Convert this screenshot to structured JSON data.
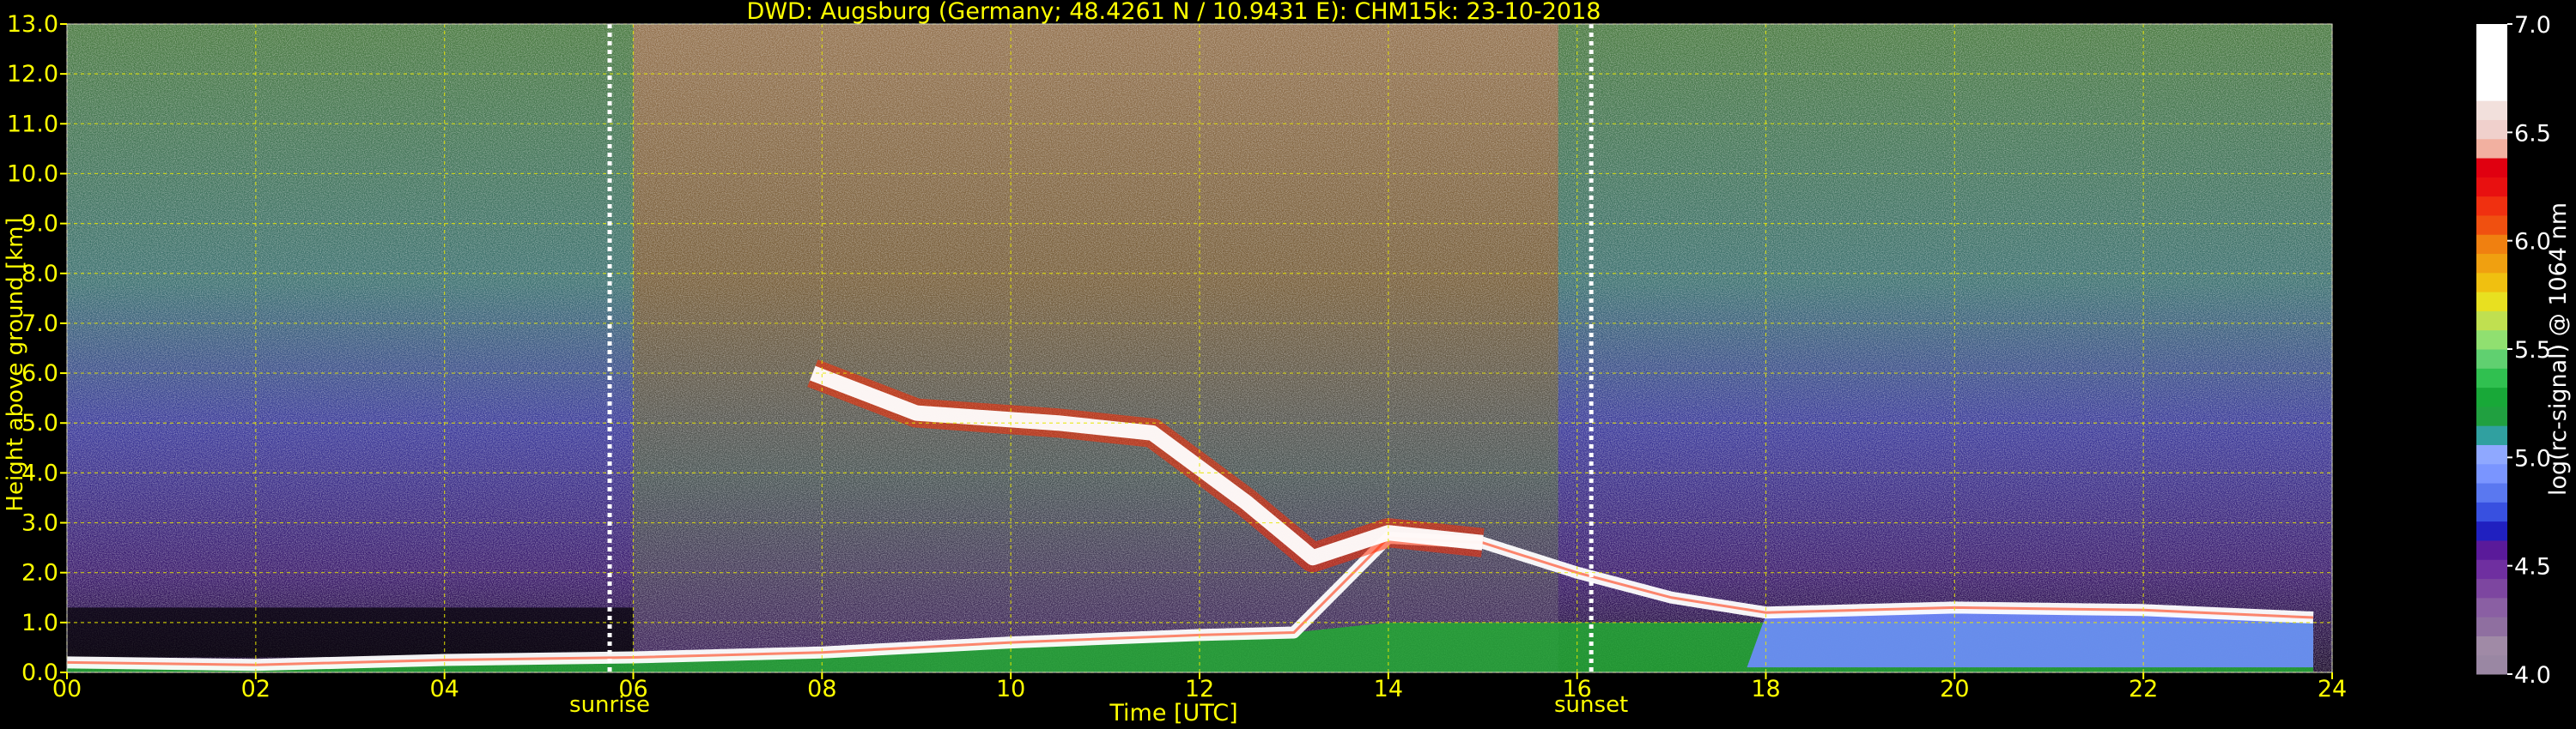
{
  "chart_data": {
    "type": "heatmap",
    "title": "DWD: Augsburg (Germany; 48.4261 N / 10.9431 E):    CHM15k: 23-10-2018",
    "xlabel": "Time [UTC]",
    "ylabel": "Height above ground [km]",
    "xlim": [
      0,
      24
    ],
    "ylim": [
      0,
      13
    ],
    "x_ticks": [
      "00",
      "02",
      "04",
      "06",
      "08",
      "10",
      "12",
      "14",
      "16",
      "18",
      "20",
      "22",
      "24"
    ],
    "y_ticks": [
      "0.0",
      "1.0",
      "2.0",
      "3.0",
      "4.0",
      "5.0",
      "6.0",
      "7.0",
      "8.0",
      "9.0",
      "10.0",
      "11.0",
      "12.0",
      "13.0"
    ],
    "grid": true,
    "markers": [
      {
        "label": "sunrise",
        "x": 5.75
      },
      {
        "label": "sunset",
        "x": 16.15
      }
    ],
    "colorbar": {
      "label": "log(rc-signal) @ 1064 nm",
      "range": [
        4.0,
        7.0
      ],
      "ticks": [
        "4.0",
        "4.5",
        "5.0",
        "5.5",
        "6.0",
        "6.5",
        "7.0"
      ]
    },
    "features": {
      "boundary_layer_top_km": [
        {
          "x": 0,
          "y": 0.2
        },
        {
          "x": 2,
          "y": 0.15
        },
        {
          "x": 4,
          "y": 0.25
        },
        {
          "x": 6,
          "y": 0.3
        },
        {
          "x": 8,
          "y": 0.4
        },
        {
          "x": 10,
          "y": 0.6
        },
        {
          "x": 12,
          "y": 0.75
        },
        {
          "x": 13,
          "y": 0.8
        },
        {
          "x": 14,
          "y": 2.7
        },
        {
          "x": 15,
          "y": 2.6
        },
        {
          "x": 16,
          "y": 2.0
        },
        {
          "x": 17,
          "y": 1.5
        },
        {
          "x": 18,
          "y": 1.2
        },
        {
          "x": 20,
          "y": 1.3
        },
        {
          "x": 22,
          "y": 1.25
        },
        {
          "x": 23.8,
          "y": 1.1
        }
      ],
      "cloud_layer_km": [
        {
          "x": 7.9,
          "y": 6.0
        },
        {
          "x": 9,
          "y": 5.2
        },
        {
          "x": 10.5,
          "y": 5.0
        },
        {
          "x": 11.5,
          "y": 4.8
        },
        {
          "x": 12.5,
          "y": 3.4
        },
        {
          "x": 13.2,
          "y": 2.3
        },
        {
          "x": 14,
          "y": 2.8
        },
        {
          "x": 15,
          "y": 2.6
        }
      ]
    }
  }
}
